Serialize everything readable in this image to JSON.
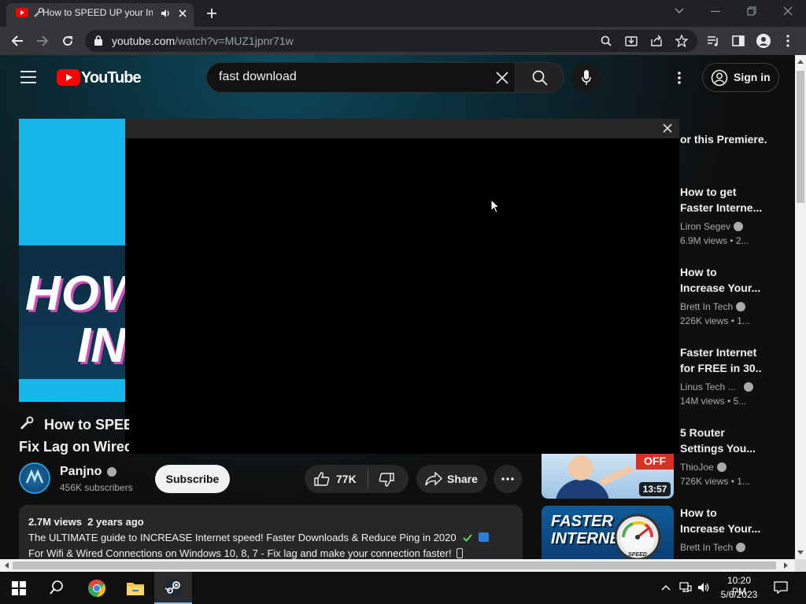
{
  "browser": {
    "tab_title": "How to SPEED UP your Inte",
    "url_host": "youtube.com",
    "url_path": "/watch?v=MUZ1jpnr71w"
  },
  "youtube": {
    "logo_text": "YouTube",
    "search_value": "fast download",
    "signin_label": "Sign in"
  },
  "video": {
    "thumb_word1": "HOW",
    "thumb_word2": "IN",
    "title_line1": "How to SPEED",
    "title_line2": "Fix Lag on Wired",
    "channel": "Panjno",
    "subscribers": "456K subscribers",
    "subscribe_label": "Subscribe",
    "likes": "77K",
    "share_label": "Share",
    "views": "2.7M views",
    "age": "2 years ago",
    "desc_line1": "The ULTIMATE guide to INCREASE Internet speed! Faster Downloads & Reduce Ping in 2020",
    "desc_line2": "For Wifi & Wired Connections on Windows 10, 8, 7 - Fix lag and make your connection faster!"
  },
  "sidebar": {
    "premiere_text": "or this Premiere.",
    "items": [
      {
        "title1": "How to get",
        "title2": "Faster Interne...",
        "channel": "Liron Segev",
        "views": "6.9M views",
        "age": "2..."
      },
      {
        "title1": "How to",
        "title2": "Increase Your...",
        "channel": "Brett In Tech",
        "views": "226K views",
        "age": "1..."
      },
      {
        "title1": "Faster Internet",
        "title2": "for FREE in 30...",
        "channel": "Linus Tech ...",
        "views": "14M views",
        "age": "5..."
      },
      {
        "title1": "5 Router",
        "title2": "Settings You...",
        "channel": "ThioJoe",
        "views": "726K views",
        "age": "1..."
      },
      {
        "title1": "How to",
        "title2": "Increase Your...",
        "channel": "Brett In Tech",
        "views": "",
        "age": ""
      }
    ],
    "thumb1_badge": "OFF",
    "thumb1_duration": "13:57",
    "thumb2_line1": "FASTER",
    "thumb2_line2": "INTERNET",
    "thumb2_gauge": "SPEED"
  },
  "taskbar": {
    "time": "10:20 PM",
    "date": "5/6/2023"
  },
  "colors": {
    "youtube_red": "#ff0000",
    "page_bg": "#0f0f0f",
    "chrome_dark": "#202124"
  }
}
